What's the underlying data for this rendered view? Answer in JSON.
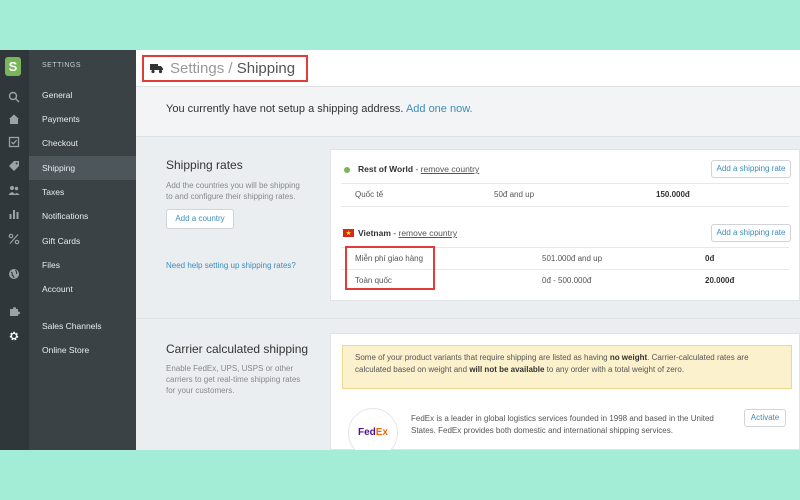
{
  "sidebar": {
    "header": "SETTINGS",
    "items": [
      {
        "label": "General"
      },
      {
        "label": "Payments"
      },
      {
        "label": "Checkout"
      },
      {
        "label": "Shipping"
      },
      {
        "label": "Taxes"
      },
      {
        "label": "Notifications"
      },
      {
        "label": "Gift Cards"
      },
      {
        "label": "Files"
      },
      {
        "label": "Account"
      },
      {
        "label": "Sales Channels"
      },
      {
        "label": "Online Store"
      }
    ],
    "active": "Shipping"
  },
  "rail": {
    "logo_letter": "S",
    "icons": [
      "search-icon",
      "home-icon",
      "orders-icon",
      "tag-icon",
      "customers-icon",
      "reports-icon",
      "discounts-icon",
      "globe-icon",
      "puzzle-icon",
      "gear-icon"
    ]
  },
  "header": {
    "breadcrumb_parent": "Settings",
    "breadcrumb_sep": " / ",
    "breadcrumb_current": "Shipping"
  },
  "notice": {
    "text": "You currently have not setup a shipping address.",
    "link": "Add one now."
  },
  "shipping_rates": {
    "title": "Shipping rates",
    "description_line1": "Add the countries you will be shipping",
    "description_line2": "to and configure their shipping rates.",
    "add_country_label": "Add a country",
    "help_link": "Need help setting up shipping rates?",
    "zones": [
      {
        "name": "Rest of World",
        "separator": " - ",
        "remove_label": "remove country",
        "add_rate_label": "Add a shipping rate",
        "rates": [
          {
            "name": "Quốc tế",
            "range": "50đ and up",
            "price": "150.000đ"
          }
        ]
      },
      {
        "name": "Vietnam",
        "separator": " - ",
        "remove_label": "remove country",
        "add_rate_label": "Add a shipping rate",
        "rates": [
          {
            "name": "Miễn phí giao hàng",
            "range": "501.000đ and up",
            "price": "0đ"
          },
          {
            "name": "Toàn quốc",
            "range": "0đ - 500.000đ",
            "price": "20.000đ"
          }
        ]
      }
    ],
    "colors": {
      "world_dot": "#7ab55c",
      "flag_red": "#da251d",
      "flag_star": "#ffff00",
      "highlight": "#e03c3c"
    }
  },
  "carrier": {
    "title": "Carrier calculated shipping",
    "description_line1": "Enable FedEx, UPS, USPS or other",
    "description_line2": "carriers to get real-time shipping rates",
    "description_line3": "for your customers.",
    "warning_part1": "Some of your product variants that require shipping are listed as having ",
    "warning_bold1": "no weight",
    "warning_part2": ". Carrier-calculated rates are calculated based on weight and ",
    "warning_bold2": "will not be available",
    "warning_part3": " to any order with a total weight of zero.",
    "fedex_logo_fed": "Fed",
    "fedex_logo_ex": "Ex",
    "fedex_text_line1": "FedEx is a leader in global logistics services founded in 1998 and based in the United",
    "fedex_text_line2": "States. FedEx provides both domestic and international shipping services.",
    "activate_label": "Activate"
  }
}
